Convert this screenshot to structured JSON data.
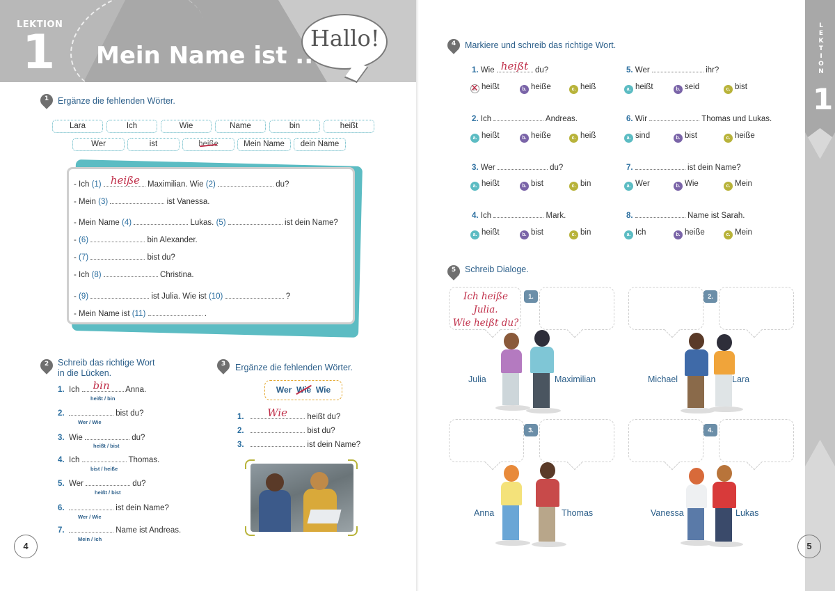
{
  "header": {
    "lektion_label": "LEKTION",
    "lektion_number": "1",
    "title": "Mein Name ist ...",
    "bubble_text": "Hallo!"
  },
  "task1": {
    "number": "1",
    "title": "Ergänze die fehlenden Wörter.",
    "word_boxes_row1": [
      "Lara",
      "Ich",
      "Wie",
      "Name",
      "bin",
      "heißt"
    ],
    "word_boxes_row2": [
      "Wer",
      "ist",
      "heiße",
      "Mein Name",
      "dein Name"
    ],
    "struck_word": "heiße",
    "lines": [
      {
        "pre": "- Ich ",
        "n1": "(1)",
        "fill1": "heiße",
        "mid": " Maximilian. Wie ",
        "n2": "(2)",
        "post": " du?"
      },
      {
        "pre": "- Mein ",
        "n1": "(3)",
        "mid": " ist Vanessa."
      },
      {
        "pre": "- Mein Name ",
        "n1": "(4)",
        "mid": " Lukas. ",
        "n2": "(5)",
        "post": " ist dein Name?"
      },
      {
        "pre": "- ",
        "n1": "(6)",
        "mid": " bin Alexander."
      },
      {
        "pre": "- ",
        "n1": "(7)",
        "mid": " bist du?"
      },
      {
        "pre": "- Ich ",
        "n1": "(8)",
        "mid": " Christina."
      },
      {
        "pre": "- ",
        "n1": "(9)",
        "mid": " ist Julia. Wie ist ",
        "n2": "(10)",
        "post": " ?"
      },
      {
        "pre": "- Mein Name ist ",
        "n1": "(11)",
        "post": " ."
      }
    ]
  },
  "task2": {
    "number": "2",
    "title_line1": "Schreib das richtige Wort",
    "title_line2": "in die Lücken.",
    "items": [
      {
        "n": "1.",
        "pre": "Ich ",
        "fill": "bin",
        "post": " Anna.",
        "hint": "heißt / bin"
      },
      {
        "n": "2.",
        "pre": "",
        "post": " bist du?",
        "hint": "Wer / Wie"
      },
      {
        "n": "3.",
        "pre": "Wie ",
        "post": " du?",
        "hint": "heißt / bist"
      },
      {
        "n": "4.",
        "pre": "Ich ",
        "post": " Thomas.",
        "hint": "bist / heiße"
      },
      {
        "n": "5.",
        "pre": "Wer ",
        "post": " du?",
        "hint": "heißt / bist"
      },
      {
        "n": "6.",
        "pre": "",
        "post": " ist dein Name?",
        "hint": "Wer / Wie"
      },
      {
        "n": "7.",
        "pre": "",
        "post": " Name ist Andreas.",
        "hint": "Mein / Ich"
      }
    ]
  },
  "task3": {
    "number": "3",
    "title": "Ergänze die fehlenden Wörter.",
    "box_words": [
      "Wer",
      "Wie",
      "Wie"
    ],
    "items": [
      {
        "n": "1.",
        "fill": "Wie",
        "post": " heißt du?"
      },
      {
        "n": "2.",
        "post": " bist du?"
      },
      {
        "n": "3.",
        "post": " ist dein Name?"
      }
    ]
  },
  "task4": {
    "number": "4",
    "title": "Markiere und schreib das richtige Wort.",
    "questions": [
      {
        "n": "1.",
        "pre": "Wie ",
        "fill": "heißt",
        "post": " du?",
        "opts": [
          "heißt",
          "heiße",
          "heiß"
        ],
        "checked": 0
      },
      {
        "n": "5.",
        "pre": "Wer ",
        "post": " ihr?",
        "opts": [
          "heißt",
          "seid",
          "bist"
        ]
      },
      {
        "n": "2.",
        "pre": "Ich ",
        "post": " Andreas.",
        "opts": [
          "heißt",
          "heiße",
          "heiß"
        ]
      },
      {
        "n": "6.",
        "pre": "Wir ",
        "post": " Thomas und Lukas.",
        "opts": [
          "sind",
          "bist",
          "heiße"
        ]
      },
      {
        "n": "3.",
        "pre": "Wer ",
        "post": " du?",
        "opts": [
          "heißt",
          "bist",
          "bin"
        ]
      },
      {
        "n": "7.",
        "pre": "",
        "post": " ist dein Name?",
        "opts": [
          "Wer",
          "Wie",
          "Mein"
        ]
      },
      {
        "n": "4.",
        "pre": "Ich ",
        "post": " Mark.",
        "opts": [
          "heißt",
          "bist",
          "bin"
        ]
      },
      {
        "n": "8.",
        "pre": "",
        "post": " Name ist Sarah.",
        "opts": [
          "Ich",
          "heiße",
          "Mein"
        ]
      }
    ],
    "letters": [
      "a.",
      "b.",
      "c."
    ]
  },
  "task5": {
    "number": "5",
    "title": "Schreib Dialoge.",
    "dialogs": [
      {
        "badge": "1.",
        "left_name": "Julia",
        "right_name": "Maximilian",
        "hand_line1": "Ich heiße",
        "hand_line2": "Julia.",
        "hand_line3": "Wie heißt du?"
      },
      {
        "badge": "2.",
        "left_name": "Michael",
        "right_name": "Lara"
      },
      {
        "badge": "3.",
        "left_name": "Anna",
        "right_name": "Thomas"
      },
      {
        "badge": "4.",
        "left_name": "Vanessa",
        "right_name": "Lukas"
      }
    ]
  },
  "side_tab": {
    "label": "LEKTION",
    "number": "1"
  },
  "page_numbers": {
    "left": "4",
    "right": "5"
  },
  "colors": {
    "accent_teal": "#5cbcc3",
    "handwriting_red": "#c0304a",
    "title_blue": "#2c5f8a",
    "option_a": "#5cbcc3",
    "option_b": "#7a64a8",
    "option_c": "#b8b33a"
  }
}
